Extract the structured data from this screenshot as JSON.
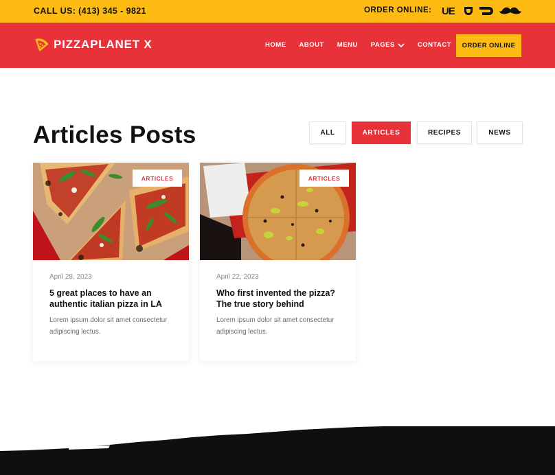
{
  "topbar": {
    "call": "CALL US: (413) 345 - 9821",
    "order_online": "ORDER ONLINE:",
    "delivery_services": [
      {
        "name": "uber-eats",
        "label": "UE"
      },
      {
        "name": "doordash",
        "label": ""
      },
      {
        "name": "grubhub",
        "label": ""
      },
      {
        "name": "postmates",
        "label": ""
      }
    ]
  },
  "header": {
    "brand": "PIZZAPLANET X",
    "nav": [
      "HOME",
      "ABOUT",
      "MENU",
      "PAGES",
      "CONTACT"
    ],
    "order_button": "ORDER ONLINE"
  },
  "colors": {
    "brand_red": "#e7323a",
    "brand_yellow": "#fdbb14",
    "dark": "#111111"
  },
  "main": {
    "title": "Articles Posts",
    "filters": [
      {
        "label": "ALL",
        "active": false
      },
      {
        "label": "ARTICLES",
        "active": true
      },
      {
        "label": "RECIPES",
        "active": false
      },
      {
        "label": "NEWS",
        "active": false
      }
    ],
    "posts": [
      {
        "tag": "ARTICLES",
        "date": "April 28, 2023",
        "title": "5 great places to have an authentic italian pizza in LA",
        "excerpt": "Lorem ipsum dolor sit amet consectetur adipiscing lectus."
      },
      {
        "tag": "ARTICLES",
        "date": "April 22, 2023",
        "title": "Who first invented the pizza? The true story behind",
        "excerpt": "Lorem ipsum dolor sit amet consectetur adipiscing lectus."
      }
    ]
  }
}
